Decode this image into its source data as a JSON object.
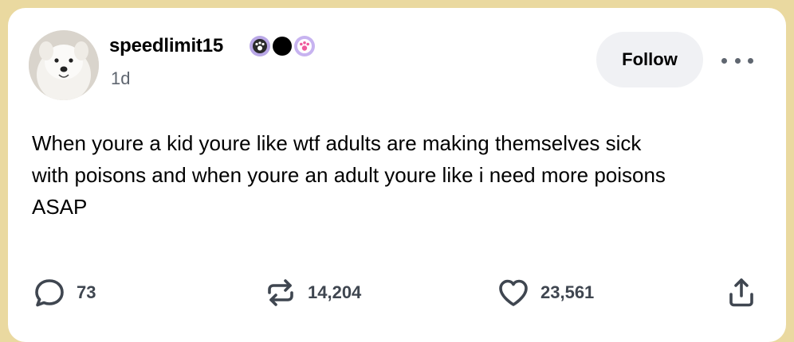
{
  "post": {
    "username": "speedlimit15",
    "time": "1d",
    "follow_label": "Follow",
    "body": "When youre a kid youre like wtf adults are making themselves sick\nwith poisons and when youre an adult youre like i need more poisons\nASAP"
  },
  "actions": {
    "replies": "73",
    "reblogs": "14,204",
    "likes": "23,561"
  },
  "icons": {
    "badges": [
      "paw-badge-icon",
      "black-dot-badge-icon",
      "pink-paw-badge-icon"
    ],
    "reply": "speech-bubble-icon",
    "reblog": "reblog-arrows-icon",
    "like": "heart-icon",
    "share": "share-icon",
    "more": "more-dots-icon"
  },
  "colors": {
    "page_background": "#ead9a0",
    "card_background": "#ffffff",
    "icon_gray": "#3f4650",
    "follow_button_bg": "#f0f1f4"
  }
}
